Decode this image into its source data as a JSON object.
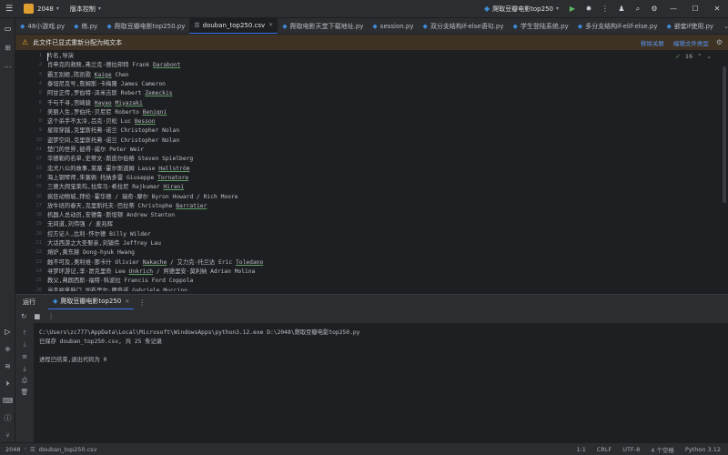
{
  "titlebar": {
    "project": "2048",
    "vcs": "版本控制",
    "run_config": "爬取豆瓣电影top250"
  },
  "tabs": [
    {
      "label": "48小游戏.py",
      "type": "py"
    },
    {
      "label": "练.py",
      "type": "py"
    },
    {
      "label": "爬取豆瓣电影top250.py",
      "type": "py"
    },
    {
      "label": "douban_top250.csv",
      "type": "csv",
      "active": true
    },
    {
      "label": "爬取电影天堂下载地址.py",
      "type": "py"
    },
    {
      "label": "session.py",
      "type": "py"
    },
    {
      "label": "双分支结构if-else语句.py",
      "type": "py"
    },
    {
      "label": "学生登陆系统.py",
      "type": "py"
    },
    {
      "label": "多分支结构if-elif-else.py",
      "type": "py"
    },
    {
      "label": "嵌套if使用.py",
      "type": "py"
    }
  ],
  "banner": {
    "message": "此文件已显式重新分配为纯文本",
    "link1": "移除关联",
    "link2": "编辑文件类型"
  },
  "editor": {
    "problem_count": "16",
    "lines": [
      {
        "n": "1",
        "text": "片名,导演"
      },
      {
        "n": "2",
        "text": "肖申克的救赎,弗兰克·德拉邦特 Frank Darabont"
      },
      {
        "n": "3",
        "text": "霸王别姬,陈凯歌 Kaige Chen"
      },
      {
        "n": "4",
        "text": "泰坦尼克号,詹姆斯·卡梅隆 James Cameron"
      },
      {
        "n": "5",
        "text": "阿甘正传,罗伯特·泽米吉斯 Robert Zemeckis"
      },
      {
        "n": "6",
        "text": "千与千寻,宫崎骏 Hayao Miyazaki"
      },
      {
        "n": "7",
        "text": "美丽人生,罗伯托·贝尼尼 Roberto Benigni"
      },
      {
        "n": "8",
        "text": "这个杀手不太冷,吕克·贝松 Luc Besson"
      },
      {
        "n": "9",
        "text": "星际穿越,克里斯托弗·诺兰 Christopher Nolan"
      },
      {
        "n": "10",
        "text": "盗梦空间,克里斯托弗·诺兰 Christopher Nolan"
      },
      {
        "n": "11",
        "text": "楚门的世界,彼得·威尔 Peter Weir"
      },
      {
        "n": "12",
        "text": "辛德勒的名单,史蒂文·斯皮尔伯格 Steven Spielberg"
      },
      {
        "n": "13",
        "text": "忠犬八公的故事,莱塞·霍尔斯道姆 Lasse Hallström"
      },
      {
        "n": "14",
        "text": "海上钢琴师,朱塞佩·托纳多雷 Giuseppe Tornatore"
      },
      {
        "n": "15",
        "text": "三傻大闹宝莱坞,拉库马·希拉尼 Rajkumar Hirani"
      },
      {
        "n": "16",
        "text": "疯狂动物城,拜伦·霍华德 / 瑞奇·摩尔 Byron Howard / Rich Moore"
      },
      {
        "n": "17",
        "text": "放牛班的春天,克里斯托夫·巴拉蒂 Christophe Barratier"
      },
      {
        "n": "18",
        "text": "机器人总动员,安德鲁·斯坦顿 Andrew Stanton"
      },
      {
        "n": "19",
        "text": "无间道,刘伟强 / 麦兆辉"
      },
      {
        "n": "20",
        "text": "控方证人,比利·怀尔德 Billy Wilder"
      },
      {
        "n": "21",
        "text": "大话西游之大圣娶亲,刘镇伟 Jeffrey Lau"
      },
      {
        "n": "22",
        "text": "熔炉,黄东赫 Dong-hyuk Hwang"
      },
      {
        "n": "23",
        "text": "触不可及,奥利维·那卡什 Olivier Nakache / 艾力克·托兰达 Eric Toledano"
      },
      {
        "n": "24",
        "text": "寻梦环游记,李·昂克里奇 Lee Unkrich / 阿德里安·莫利纳 Adrian Molina"
      },
      {
        "n": "25",
        "text": "教父,弗朗西斯·福特·科波拉 Francis Ford Coppola"
      },
      {
        "n": "26",
        "text": "当幸福来敲门,加布里尔·穆奇诺 Gabriele Muccino"
      }
    ]
  },
  "run": {
    "label": "运行",
    "tab": "爬取豆瓣电影top250",
    "console": [
      "C:\\Users\\zc777\\AppData\\Local\\Microsoft\\WindowsApps\\python3.12.exe D:\\2048\\爬取豆瓣电影top250.py",
      "已保存 douban_top250.csv, 共 25 条记录",
      "",
      "进程已结束,退出代码为 0"
    ]
  },
  "statusbar": {
    "project": "2048",
    "file": "douban_top250.csv",
    "position": "1:1",
    "line_sep": "CRLF",
    "encoding": "UTF-8",
    "indent": "4 个空格",
    "interpreter": "Python 3.12"
  },
  "colors": {
    "bg": "#1e1f22",
    "panel": "#2b2d30",
    "accent": "#3574f0",
    "banner": "#3d3223",
    "warn": "#e8a33c",
    "run_green": "#5fb865"
  }
}
